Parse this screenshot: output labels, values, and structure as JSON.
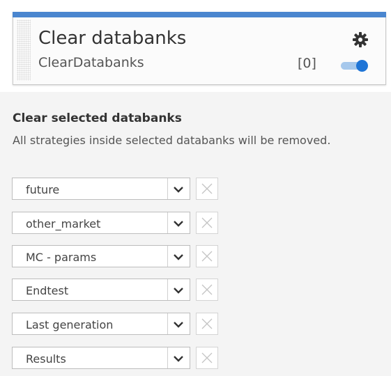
{
  "card": {
    "title": "Clear databanks",
    "subtitle": "ClearDatabanks",
    "count": "[0]",
    "toggle_on": true,
    "accent_color": "#4a86cf",
    "toggle_color": "#1f75d6",
    "icons": [
      "gear-icon",
      "toggle-switch"
    ]
  },
  "panel": {
    "title": "Clear selected databanks",
    "description": "All strategies inside selected databanks will be removed."
  },
  "databanks": [
    {
      "value": "future"
    },
    {
      "value": "other_market"
    },
    {
      "value": "MC - params"
    },
    {
      "value": "Endtest"
    },
    {
      "value": "Last generation"
    },
    {
      "value": "Results"
    }
  ]
}
